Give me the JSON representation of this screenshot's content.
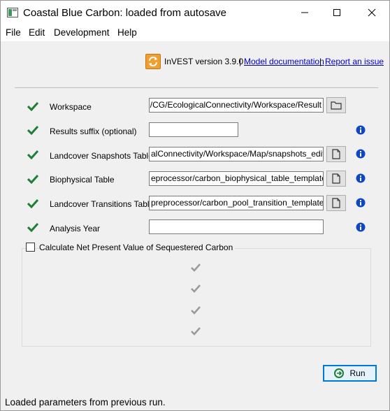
{
  "window": {
    "title": "Coastal Blue Carbon: loaded from autosave",
    "controls": [
      "minimize-icon",
      "maximize-icon",
      "close-icon"
    ]
  },
  "menu": {
    "items": [
      "File",
      "Edit",
      "Development",
      "Help"
    ]
  },
  "header": {
    "version_text": "InVEST version 3.9.0",
    "separator": "|",
    "model_doc_link": "Model documentation",
    "report_issue_link": "Report an issue"
  },
  "form": {
    "rows": [
      {
        "label": "Workspace",
        "value": "y tính/CG/EcologicalConnectivity/Workspace/Result",
        "button_icon": "folder-icon",
        "info": false
      },
      {
        "label": "Results suffix (optional)",
        "value": "",
        "button_icon": null,
        "info": true
      },
      {
        "label": "Landcover Snapshots Table",
        "value": "alConnectivity/Workspace/Map/snapshots_edit.csv",
        "button_icon": "file-icon",
        "info": true
      },
      {
        "label": "Biophysical Table",
        "value": "eprocessor/carbon_biophysical_table_template.csv",
        "button_icon": "file-icon",
        "info": true
      },
      {
        "label": "Landcover Transitions Table",
        "value": "preprocessor/carbon_pool_transition_template.csv",
        "button_icon": "file-icon",
        "info": true
      },
      {
        "label": "Analysis Year",
        "value": "",
        "button_icon": null,
        "info": true
      }
    ]
  },
  "npv": {
    "label": "Calculate Net Present Value of Sequestered Carbon",
    "checked": false,
    "inner_checks": 4
  },
  "run_button": {
    "label": "Run"
  },
  "status": {
    "text": "Loaded parameters from previous run."
  },
  "colors": {
    "check_green": "#1e7e34",
    "info_blue": "#0d47c8",
    "link_blue": "#0000cc",
    "accent": "#0078d7",
    "refresh_orange": "#f0a030"
  }
}
